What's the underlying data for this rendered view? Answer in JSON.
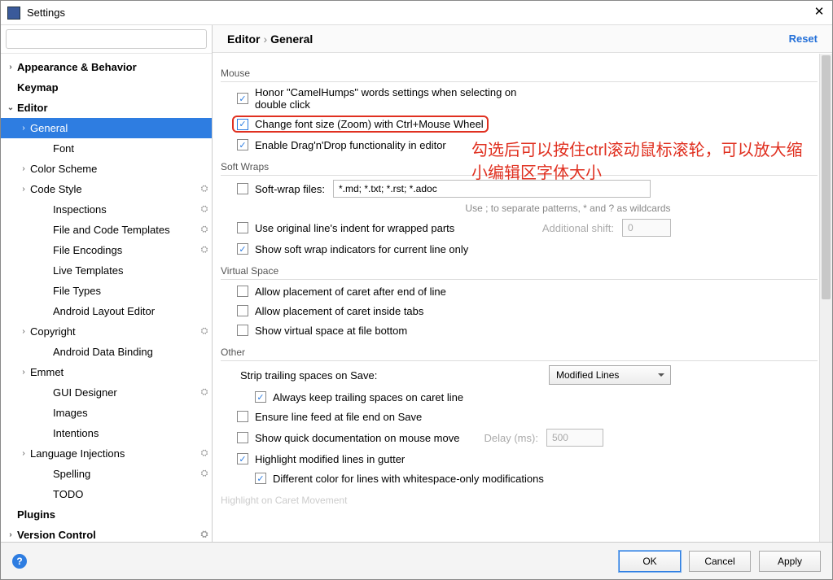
{
  "window": {
    "title": "Settings"
  },
  "search": {
    "placeholder": ""
  },
  "sidebar": [
    {
      "label": "Appearance & Behavior",
      "depth": 0,
      "chev": "›",
      "gear": false
    },
    {
      "label": "Keymap",
      "depth": 0,
      "chev": "",
      "gear": false
    },
    {
      "label": "Editor",
      "depth": 0,
      "chev": "⌄",
      "gear": false
    },
    {
      "label": "General",
      "depth": 1,
      "chev": "›",
      "gear": false,
      "selected": true
    },
    {
      "label": "Font",
      "depth": 2,
      "chev": "",
      "gear": false
    },
    {
      "label": "Color Scheme",
      "depth": 1,
      "chev": "›",
      "gear": false
    },
    {
      "label": "Code Style",
      "depth": 1,
      "chev": "›",
      "gear": true
    },
    {
      "label": "Inspections",
      "depth": 2,
      "chev": "",
      "gear": true
    },
    {
      "label": "File and Code Templates",
      "depth": 2,
      "chev": "",
      "gear": true
    },
    {
      "label": "File Encodings",
      "depth": 2,
      "chev": "",
      "gear": true
    },
    {
      "label": "Live Templates",
      "depth": 2,
      "chev": "",
      "gear": false
    },
    {
      "label": "File Types",
      "depth": 2,
      "chev": "",
      "gear": false
    },
    {
      "label": "Android Layout Editor",
      "depth": 2,
      "chev": "",
      "gear": false
    },
    {
      "label": "Copyright",
      "depth": 1,
      "chev": "›",
      "gear": true
    },
    {
      "label": "Android Data Binding",
      "depth": 2,
      "chev": "",
      "gear": false
    },
    {
      "label": "Emmet",
      "depth": 1,
      "chev": "›",
      "gear": false
    },
    {
      "label": "GUI Designer",
      "depth": 2,
      "chev": "",
      "gear": true
    },
    {
      "label": "Images",
      "depth": 2,
      "chev": "",
      "gear": false
    },
    {
      "label": "Intentions",
      "depth": 2,
      "chev": "",
      "gear": false
    },
    {
      "label": "Language Injections",
      "depth": 1,
      "chev": "›",
      "gear": true
    },
    {
      "label": "Spelling",
      "depth": 2,
      "chev": "",
      "gear": true
    },
    {
      "label": "TODO",
      "depth": 2,
      "chev": "",
      "gear": false
    },
    {
      "label": "Plugins",
      "depth": 0,
      "chev": "",
      "gear": false
    },
    {
      "label": "Version Control",
      "depth": 0,
      "chev": "›",
      "gear": true
    }
  ],
  "breadcrumb": {
    "part1": "Editor",
    "part2": "General"
  },
  "reset": "Reset",
  "sections": {
    "mouse": {
      "title": "Mouse",
      "honor": "Honor \"CamelHumps\" words settings when selecting on double click",
      "zoom": "Change font size (Zoom) with Ctrl+Mouse Wheel",
      "dnd": "Enable Drag'n'Drop functionality in editor"
    },
    "softwraps": {
      "title": "Soft Wraps",
      "files_label": "Soft-wrap files:",
      "files_value": "*.md; *.txt; *.rst; *.adoc",
      "hint": "Use ; to separate patterns, * and ? as wildcards",
      "orig_indent": "Use original line's indent for wrapped parts",
      "add_shift": "Additional shift:",
      "add_shift_val": "0",
      "show_ind": "Show soft wrap indicators for current line only"
    },
    "vspace": {
      "title": "Virtual Space",
      "caret_end": "Allow placement of caret after end of line",
      "caret_tabs": "Allow placement of caret inside tabs",
      "file_bottom": "Show virtual space at file bottom"
    },
    "other": {
      "title": "Other",
      "strip_label": "Strip trailing spaces on Save:",
      "strip_value": "Modified Lines",
      "keep_trailing": "Always keep trailing spaces on caret line",
      "ensure_lf": "Ensure line feed at file end on Save",
      "quick_doc": "Show quick documentation on mouse move",
      "delay_label": "Delay (ms):",
      "delay_value": "500",
      "highlight_mod": "Highlight modified lines in gutter",
      "diff_color": "Different color for lines with whitespace-only modifications",
      "caret_move": "Highlight on Caret Movement"
    }
  },
  "annotation": "勾选后可以按住ctrl滚动鼠标滚轮，可以放大缩小编辑区字体大小",
  "buttons": {
    "ok": "OK",
    "cancel": "Cancel",
    "apply": "Apply"
  }
}
